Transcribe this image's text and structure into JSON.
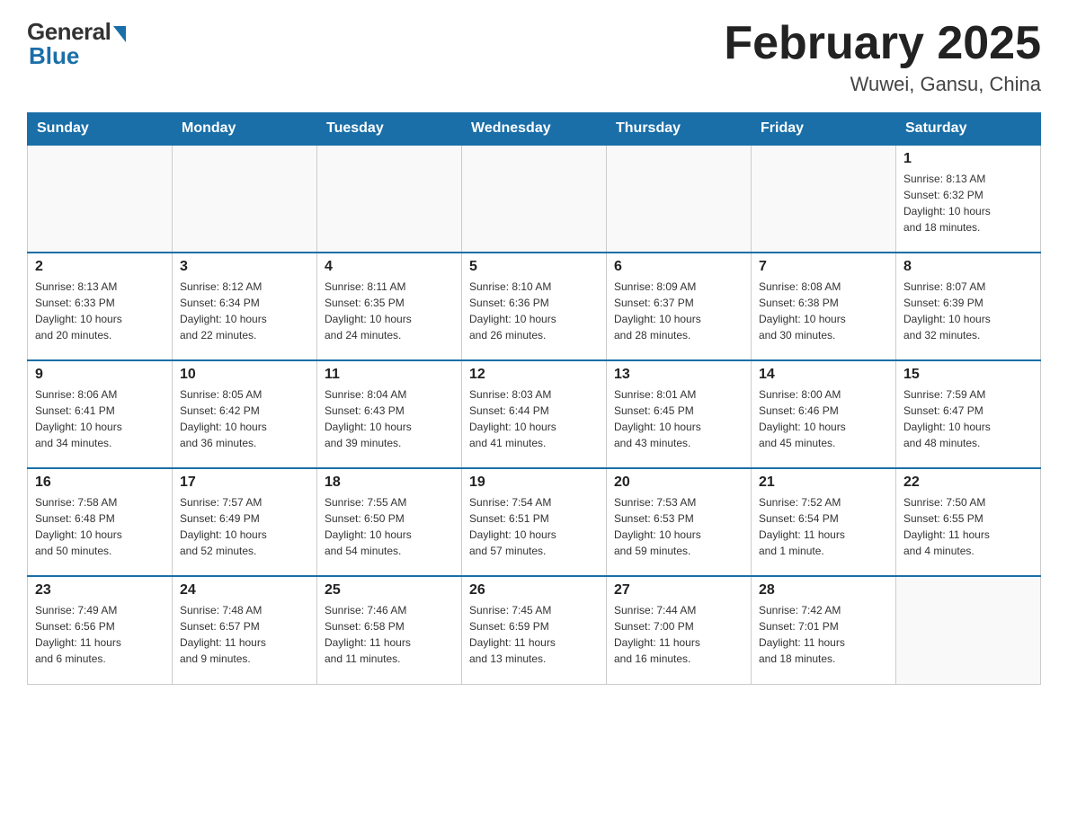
{
  "header": {
    "logo": {
      "general": "General",
      "blue": "Blue"
    },
    "title": "February 2025",
    "location": "Wuwei, Gansu, China"
  },
  "weekdays": [
    "Sunday",
    "Monday",
    "Tuesday",
    "Wednesday",
    "Thursday",
    "Friday",
    "Saturday"
  ],
  "weeks": [
    [
      {
        "day": "",
        "info": ""
      },
      {
        "day": "",
        "info": ""
      },
      {
        "day": "",
        "info": ""
      },
      {
        "day": "",
        "info": ""
      },
      {
        "day": "",
        "info": ""
      },
      {
        "day": "",
        "info": ""
      },
      {
        "day": "1",
        "info": "Sunrise: 8:13 AM\nSunset: 6:32 PM\nDaylight: 10 hours\nand 18 minutes."
      }
    ],
    [
      {
        "day": "2",
        "info": "Sunrise: 8:13 AM\nSunset: 6:33 PM\nDaylight: 10 hours\nand 20 minutes."
      },
      {
        "day": "3",
        "info": "Sunrise: 8:12 AM\nSunset: 6:34 PM\nDaylight: 10 hours\nand 22 minutes."
      },
      {
        "day": "4",
        "info": "Sunrise: 8:11 AM\nSunset: 6:35 PM\nDaylight: 10 hours\nand 24 minutes."
      },
      {
        "day": "5",
        "info": "Sunrise: 8:10 AM\nSunset: 6:36 PM\nDaylight: 10 hours\nand 26 minutes."
      },
      {
        "day": "6",
        "info": "Sunrise: 8:09 AM\nSunset: 6:37 PM\nDaylight: 10 hours\nand 28 minutes."
      },
      {
        "day": "7",
        "info": "Sunrise: 8:08 AM\nSunset: 6:38 PM\nDaylight: 10 hours\nand 30 minutes."
      },
      {
        "day": "8",
        "info": "Sunrise: 8:07 AM\nSunset: 6:39 PM\nDaylight: 10 hours\nand 32 minutes."
      }
    ],
    [
      {
        "day": "9",
        "info": "Sunrise: 8:06 AM\nSunset: 6:41 PM\nDaylight: 10 hours\nand 34 minutes."
      },
      {
        "day": "10",
        "info": "Sunrise: 8:05 AM\nSunset: 6:42 PM\nDaylight: 10 hours\nand 36 minutes."
      },
      {
        "day": "11",
        "info": "Sunrise: 8:04 AM\nSunset: 6:43 PM\nDaylight: 10 hours\nand 39 minutes."
      },
      {
        "day": "12",
        "info": "Sunrise: 8:03 AM\nSunset: 6:44 PM\nDaylight: 10 hours\nand 41 minutes."
      },
      {
        "day": "13",
        "info": "Sunrise: 8:01 AM\nSunset: 6:45 PM\nDaylight: 10 hours\nand 43 minutes."
      },
      {
        "day": "14",
        "info": "Sunrise: 8:00 AM\nSunset: 6:46 PM\nDaylight: 10 hours\nand 45 minutes."
      },
      {
        "day": "15",
        "info": "Sunrise: 7:59 AM\nSunset: 6:47 PM\nDaylight: 10 hours\nand 48 minutes."
      }
    ],
    [
      {
        "day": "16",
        "info": "Sunrise: 7:58 AM\nSunset: 6:48 PM\nDaylight: 10 hours\nand 50 minutes."
      },
      {
        "day": "17",
        "info": "Sunrise: 7:57 AM\nSunset: 6:49 PM\nDaylight: 10 hours\nand 52 minutes."
      },
      {
        "day": "18",
        "info": "Sunrise: 7:55 AM\nSunset: 6:50 PM\nDaylight: 10 hours\nand 54 minutes."
      },
      {
        "day": "19",
        "info": "Sunrise: 7:54 AM\nSunset: 6:51 PM\nDaylight: 10 hours\nand 57 minutes."
      },
      {
        "day": "20",
        "info": "Sunrise: 7:53 AM\nSunset: 6:53 PM\nDaylight: 10 hours\nand 59 minutes."
      },
      {
        "day": "21",
        "info": "Sunrise: 7:52 AM\nSunset: 6:54 PM\nDaylight: 11 hours\nand 1 minute."
      },
      {
        "day": "22",
        "info": "Sunrise: 7:50 AM\nSunset: 6:55 PM\nDaylight: 11 hours\nand 4 minutes."
      }
    ],
    [
      {
        "day": "23",
        "info": "Sunrise: 7:49 AM\nSunset: 6:56 PM\nDaylight: 11 hours\nand 6 minutes."
      },
      {
        "day": "24",
        "info": "Sunrise: 7:48 AM\nSunset: 6:57 PM\nDaylight: 11 hours\nand 9 minutes."
      },
      {
        "day": "25",
        "info": "Sunrise: 7:46 AM\nSunset: 6:58 PM\nDaylight: 11 hours\nand 11 minutes."
      },
      {
        "day": "26",
        "info": "Sunrise: 7:45 AM\nSunset: 6:59 PM\nDaylight: 11 hours\nand 13 minutes."
      },
      {
        "day": "27",
        "info": "Sunrise: 7:44 AM\nSunset: 7:00 PM\nDaylight: 11 hours\nand 16 minutes."
      },
      {
        "day": "28",
        "info": "Sunrise: 7:42 AM\nSunset: 7:01 PM\nDaylight: 11 hours\nand 18 minutes."
      },
      {
        "day": "",
        "info": ""
      }
    ]
  ]
}
